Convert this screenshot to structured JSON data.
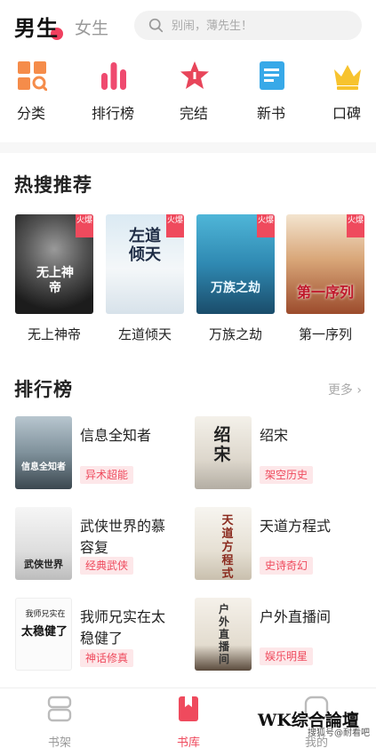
{
  "header": {
    "tab_male": "男生",
    "tab_female": "女生",
    "search_placeholder": "别闹，薄先生！"
  },
  "categories": [
    {
      "label": "分类",
      "icon": "category-grid-icon"
    },
    {
      "label": "排行榜",
      "icon": "ranking-bars-icon"
    },
    {
      "label": "完结",
      "icon": "completed-star-icon"
    },
    {
      "label": "新书",
      "icon": "new-book-icon"
    },
    {
      "label": "口碑",
      "icon": "crown-icon"
    }
  ],
  "hot": {
    "title": "热搜推荐",
    "badge": "火爆",
    "items": [
      {
        "name": "无上神帝",
        "cover_text": "无上神帝"
      },
      {
        "name": "左道倾天",
        "cover_text": "左道倾天"
      },
      {
        "name": "万族之劫",
        "cover_text": "万族之劫"
      },
      {
        "name": "第一序列",
        "cover_text": "第一序列"
      }
    ]
  },
  "ranking": {
    "title": "排行榜",
    "more": "更多",
    "items": [
      {
        "title": "信息全知者",
        "tag": "异术超能",
        "cover_text": "信息全知者"
      },
      {
        "title": "绍宋",
        "tag": "架空历史",
        "cover_text": "绍宋"
      },
      {
        "title": "武侠世界的慕容复",
        "tag": "经典武侠",
        "cover_text": "武侠世界"
      },
      {
        "title": "天道方程式",
        "tag": "史诗奇幻",
        "cover_text": "天道方程式"
      },
      {
        "title": "我师兄实在太稳健了",
        "tag": "神话修真",
        "cover_text": "太稳健了",
        "cover_top": "我师兄实在"
      },
      {
        "title": "户外直播间",
        "tag": "娱乐明星",
        "cover_text": "户外直播间"
      }
    ]
  },
  "bottom_nav": [
    {
      "label": "书架",
      "icon": "bookshelf-icon",
      "active": false
    },
    {
      "label": "书库",
      "icon": "library-book-icon",
      "active": true
    },
    {
      "label": "我的",
      "icon": "profile-icon",
      "active": false
    }
  ],
  "watermark": "WK综合論壇",
  "watermark_small": "搜狐号@耐看吧",
  "colors": {
    "accent": "#ef4a5d",
    "tag_bg": "#fde7e9",
    "muted": "#999999"
  }
}
